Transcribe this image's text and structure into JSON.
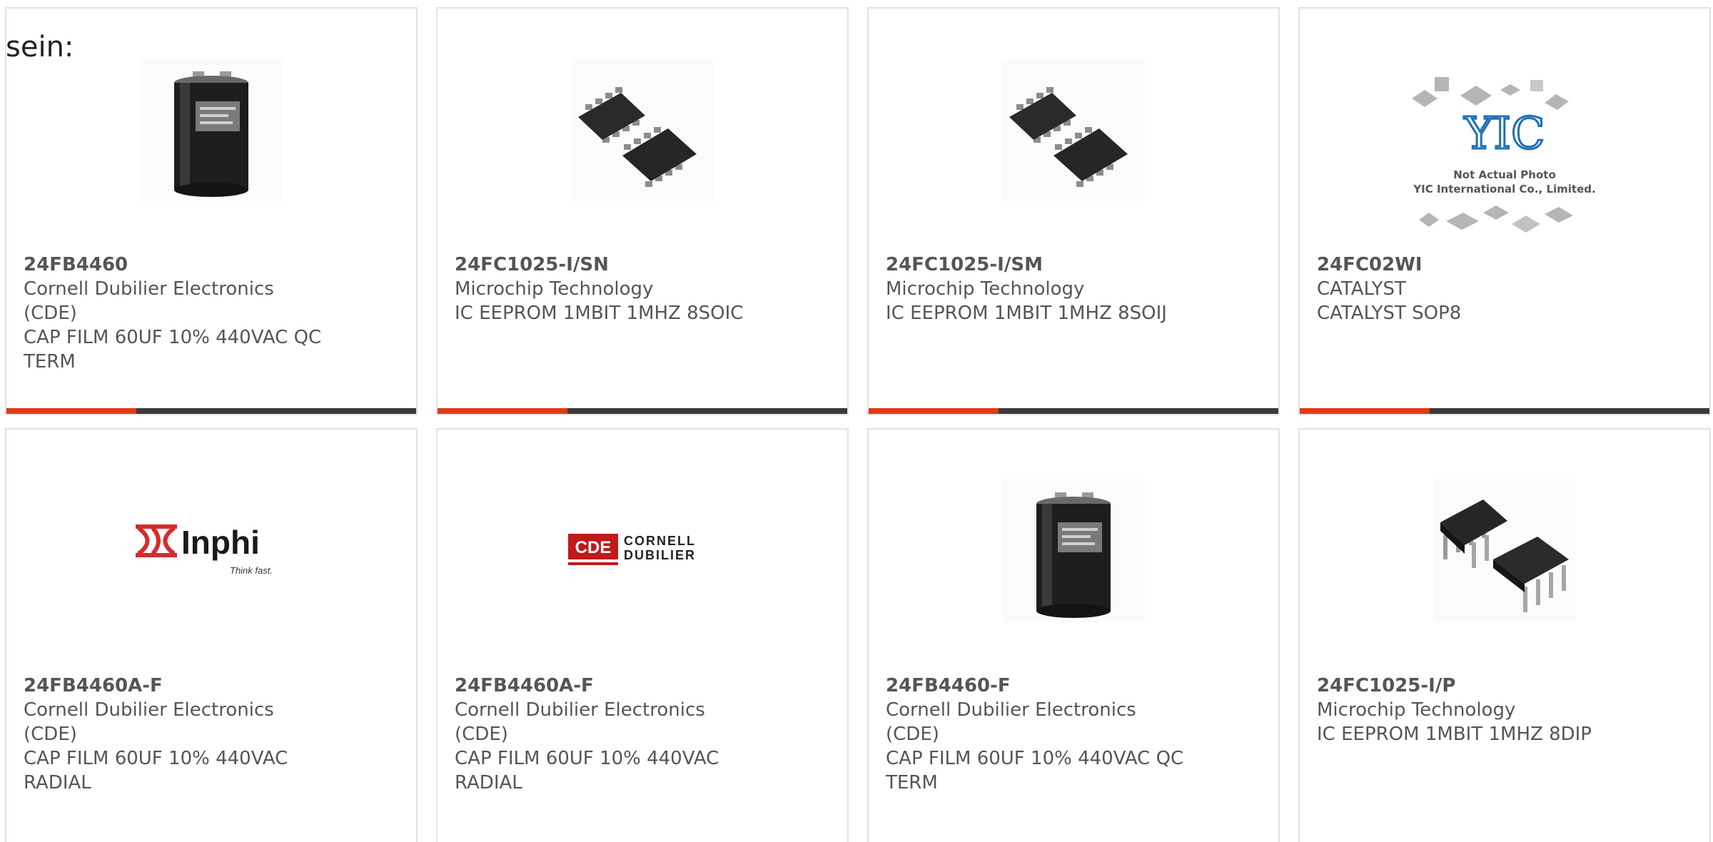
{
  "lead_text": "sein:",
  "colors": {
    "accent": "#e03a12",
    "bar": "#3b3b3b",
    "border": "#e2e2e2",
    "text": "#555555"
  },
  "products": [
    {
      "part": "24FB4460",
      "manufacturer": "Cornell Dubilier Electronics (CDE)",
      "description": "CAP FILM 60UF 10% 440VAC QC TERM",
      "image": "capacitor-image"
    },
    {
      "part": "24FC1025-I/SN",
      "manufacturer": "Microchip Technology",
      "description": "IC EEPROM 1MBIT 1MHZ 8SOIC",
      "image": "soic-chip-image"
    },
    {
      "part": "24FC1025-I/SM",
      "manufacturer": "Microchip Technology",
      "description": "IC EEPROM 1MBIT 1MHZ 8SOIJ",
      "image": "soic-chip-image"
    },
    {
      "part": "24FC02WI",
      "manufacturer": "CATALYST",
      "description": "CATALYST SOP8",
      "image": "yic-placeholder-image",
      "image_text": {
        "logo": "YIC",
        "line1": "Not Actual Photo",
        "line2": "YIC International Co., Limited."
      }
    },
    {
      "part": "24FB4460A-F",
      "manufacturer": "Cornell Dubilier Electronics (CDE)",
      "description": "CAP FILM 60UF 10% 440VAC RADIAL",
      "image": "inphi-logo-image",
      "image_text": {
        "logo": "Inphi",
        "tagline": "Think fast."
      }
    },
    {
      "part": "24FB4460A-F",
      "manufacturer": "Cornell Dubilier Electronics (CDE)",
      "description": "CAP FILM 60UF 10% 440VAC RADIAL",
      "image": "cde-logo-image",
      "image_text": {
        "logo": "CDE",
        "line1": "CORNELL",
        "line2": "DUBILIER"
      }
    },
    {
      "part": "24FB4460-F",
      "manufacturer": "Cornell Dubilier Electronics (CDE)",
      "description": "CAP FILM 60UF 10% 440VAC QC TERM",
      "image": "capacitor-image"
    },
    {
      "part": "24FC1025-I/P",
      "manufacturer": "Microchip Technology",
      "description": "IC EEPROM 1MBIT 1MHZ 8DIP",
      "image": "dip-chip-image"
    }
  ]
}
